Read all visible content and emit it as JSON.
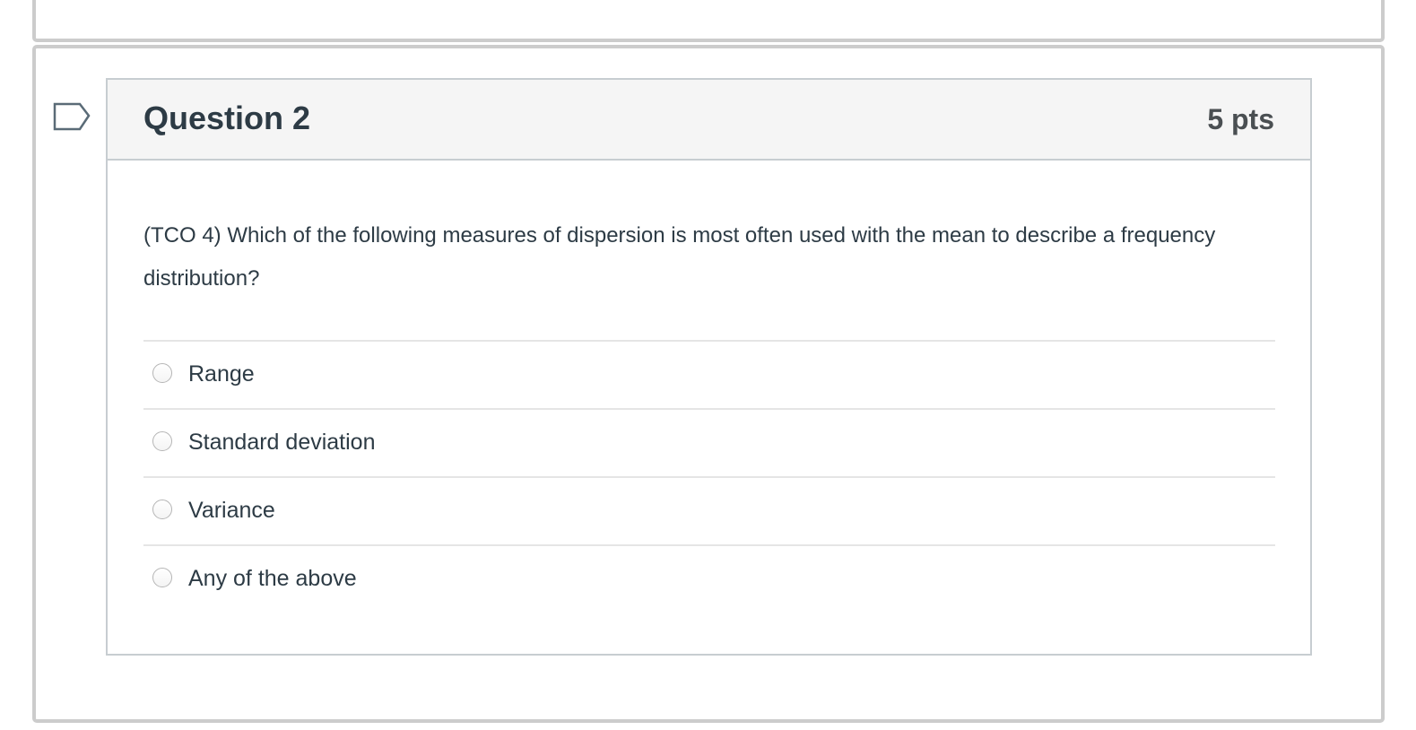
{
  "question": {
    "title": "Question 2",
    "points": "5 pts",
    "text": "(TCO 4) Which of the following measures of dispersion is most often used with the mean to describe a frequency distribution?",
    "flag_icon": "flag-question-icon",
    "answers": [
      {
        "label": "Range",
        "selected": false
      },
      {
        "label": "Standard deviation",
        "selected": false
      },
      {
        "label": "Variance",
        "selected": false
      },
      {
        "label": "Any of the above",
        "selected": false
      }
    ]
  },
  "colors": {
    "header_bg": "#f5f5f5",
    "text": "#2d3b45",
    "border": "#c7cdd1",
    "outer_border": "#cccccc"
  }
}
